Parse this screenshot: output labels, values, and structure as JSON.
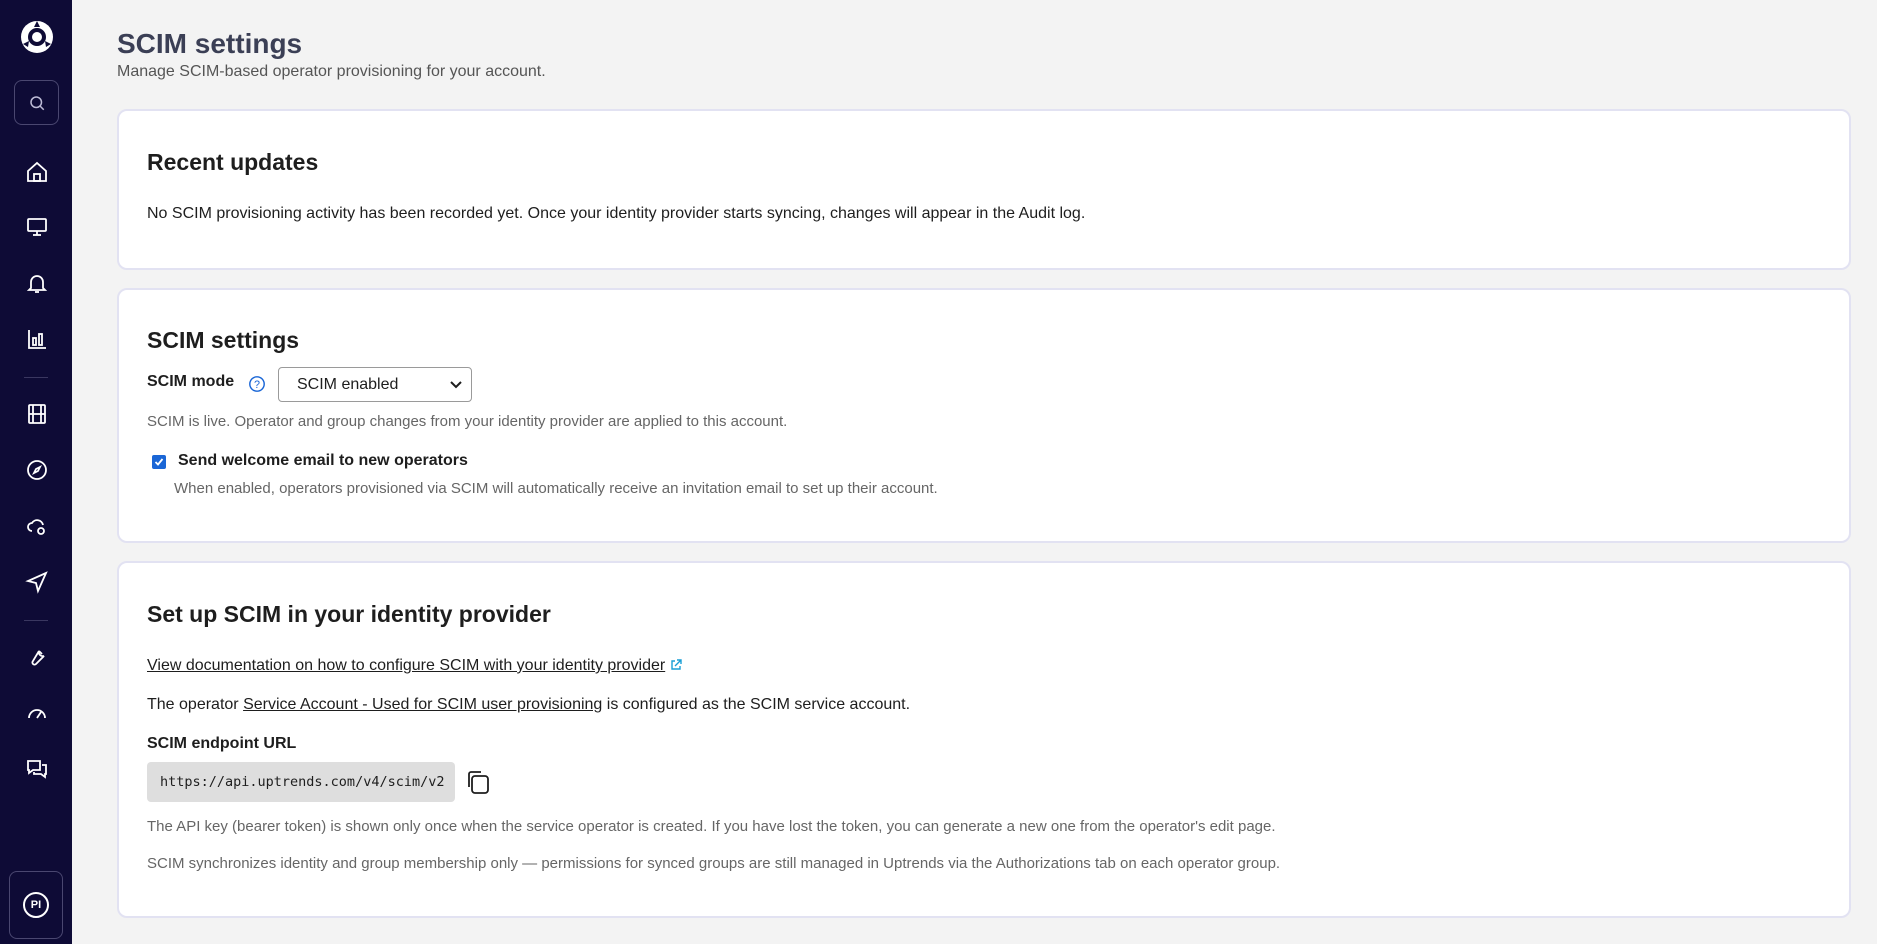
{
  "sidebar": {
    "avatar_initials": "PI",
    "icons": [
      "logo-icon",
      "search-icon",
      "home-icon",
      "monitor-icon",
      "bell-icon",
      "chart-icon",
      "film-icon",
      "compass-icon",
      "cloud-gear-icon",
      "send-icon",
      "wrench-icon",
      "gauge-icon",
      "chat-icon"
    ],
    "background": "#0e0b36"
  },
  "header": {
    "title": "SCIM settings",
    "subtitle": "Manage SCIM-based operator provisioning for your account."
  },
  "recent_updates": {
    "title": "Recent updates",
    "text": "No SCIM provisioning activity has been recorded yet. Once your identity provider starts syncing, changes will appear in the Audit log."
  },
  "scim_settings": {
    "title": "SCIM settings",
    "mode_label": "SCIM mode",
    "mode_value": "SCIM enabled",
    "mode_help": "SCIM is live. Operator and group changes from your identity provider are applied to this account.",
    "welcome_checked": true,
    "welcome_label": "Send welcome email to new operators",
    "welcome_help": "When enabled, operators provisioned via SCIM will automatically receive an invitation email to set up their account."
  },
  "setup": {
    "title": "Set up SCIM in your identity provider",
    "doc_link": "View documentation on how to configure SCIM with your identity provider",
    "operator_prefix": "The operator",
    "operator_link": "Service Account - Used for SCIM user provisioning",
    "operator_suffix": "is configured as the SCIM service account.",
    "endpoint_label": "SCIM endpoint URL",
    "endpoint_url": "https://api.uptrends.com/v4/scim/v2",
    "note1": "The API key (bearer token) is shown only once when the service operator is created. If you have lost the token, you can generate a new one from the operator's edit page.",
    "note2": "SCIM synchronizes identity and group membership only — permissions for synced groups are still managed in Uptrends via the Authorizations tab on each operator group."
  },
  "colors": {
    "accent": "#1a66d6",
    "card_border": "#e2e2f2",
    "page_bg": "#f3f3f3"
  }
}
